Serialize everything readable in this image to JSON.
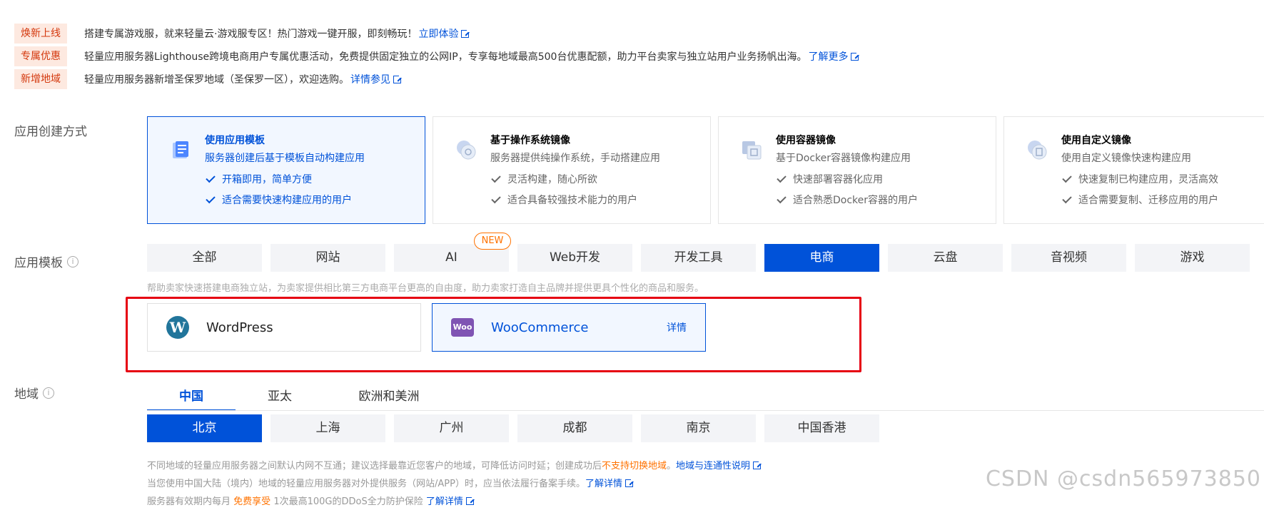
{
  "notices": [
    {
      "tag": "焕新上线",
      "text": "搭建专属游戏服，就来轻量云·游戏服专区！热门游戏一键开服，即刻畅玩！",
      "link": "立即体验"
    },
    {
      "tag": "专属优惠",
      "text": "轻量应用服务器Lighthouse跨境电商用户专属优惠活动，免费提供固定独立的公网IP，专享每地域最高500台优惠配额，助力平台卖家与独立站用户业务扬帆出海。",
      "link": "了解更多"
    },
    {
      "tag": "新增地域",
      "text": "轻量应用服务器新增圣保罗地域（圣保罗一区），欢迎选购。",
      "link": "详情参见"
    }
  ],
  "creation": {
    "label": "应用创建方式",
    "methods": [
      {
        "title": "使用应用模板",
        "desc": "服务器创建后基于模板自动构建应用",
        "features": [
          "开箱即用，简单方便",
          "适合需要快速构建应用的用户"
        ],
        "icon": "template-icon"
      },
      {
        "title": "基于操作系统镜像",
        "desc": "服务器提供纯操作系统，手动搭建应用",
        "features": [
          "灵活构建，随心所欲",
          "适合具备较强技术能力的用户"
        ],
        "icon": "os-image-icon"
      },
      {
        "title": "使用容器镜像",
        "desc": "基于Docker容器镜像构建应用",
        "features": [
          "快速部署容器化应用",
          "适合熟悉Docker容器的用户"
        ],
        "icon": "container-image-icon"
      },
      {
        "title": "使用自定义镜像",
        "desc": "使用自定义镜像快速构建应用",
        "features": [
          "快速复制已构建应用，灵活高效",
          "适合需要复制、迁移应用的用户"
        ],
        "icon": "custom-image-icon"
      }
    ]
  },
  "templates": {
    "label": "应用模板",
    "info_icon": "i",
    "categories": [
      "全部",
      "网站",
      "AI",
      "Web开发",
      "开发工具",
      "电商",
      "云盘",
      "音视频",
      "游戏"
    ],
    "active_category": "电商",
    "new_badge": "NEW",
    "hint": "帮助卖家快速搭建电商独立站，为卖家提供相比第三方电商平台更高的自由度，助力卖家打造自主品牌并提供更具个性化的商品和服务。",
    "apps": [
      {
        "name": "WordPress",
        "logo": "W"
      },
      {
        "name": "WooCommerce",
        "logo": "Woo",
        "detail": "详情"
      }
    ]
  },
  "region": {
    "label": "地域",
    "info_icon": "i",
    "areas": [
      "中国",
      "亚太",
      "欧洲和美洲"
    ],
    "cities": [
      "北京",
      "上海",
      "广州",
      "成都",
      "南京",
      "中国香港"
    ],
    "note1_pre": "不同地域的轻量应用服务器之间默认内网不互通；建议选择最靠近您客户的地域，可降低访问时延；创建成功后",
    "note1_warn": "不支持切换地域",
    "note1_post": "。",
    "note1_link": "地域与连通性说明",
    "note2": "当您使用中国大陆（境内）地域的轻量应用服务器对外提供服务（网站/APP）时，应当依法履行备案手续。",
    "note2_link": "了解详情",
    "note3_pre": "服务器有效期内每月",
    "note3_warn": "免费享受",
    "note3_post": "1次最高100G的DDoS全力防护保险",
    "note3_link": "了解详情"
  },
  "watermark": "CSDN @csdn565973850",
  "colors": {
    "primary": "#0052d9",
    "tag_bg": "#fde9e0",
    "tag_text": "#d4380d",
    "warn": "#ff7200",
    "highlight_box": "#e60012"
  }
}
